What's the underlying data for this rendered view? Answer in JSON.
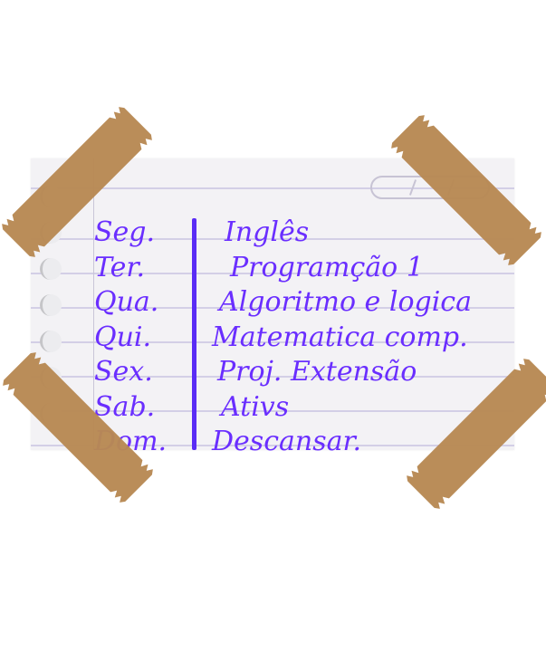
{
  "schedule": {
    "rows": [
      {
        "day": "Seg.",
        "subject": "Inglês"
      },
      {
        "day": "Ter.",
        "subject": "Programção 1"
      },
      {
        "day": "Qua.",
        "subject": "Algoritmo e logica"
      },
      {
        "day": "Qui.",
        "subject": "Matematica comp."
      },
      {
        "day": "Sex.",
        "subject": "Proj. Extensão"
      },
      {
        "day": "Sab.",
        "subject": "Ativs"
      },
      {
        "day": "Dom.",
        "subject": "Descansar."
      }
    ]
  },
  "colors": {
    "ink": "#6a2eff",
    "tape": "#b88954",
    "paper": "#f3f2f5",
    "rule": "#d3cfe6"
  },
  "icons": {
    "binder_hole": "binder-hole-icon",
    "date_field": "date-field-icon"
  }
}
